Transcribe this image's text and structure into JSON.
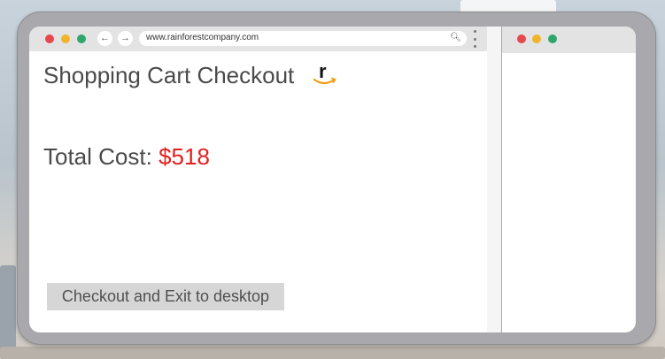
{
  "browser": {
    "url": "www.rainforestcompany.com",
    "back_icon": "arrow-left-icon",
    "forward_icon": "arrow-right-icon",
    "search_icon": "search-icon",
    "menu_icon": "vertical-dots-icon"
  },
  "page": {
    "title": "Shopping Cart Checkout",
    "logo_letter": "r",
    "total_label": "Total Cost: ",
    "total_value": "$518",
    "checkout_button": "Checkout and Exit to desktop"
  },
  "colors": {
    "traffic_red": "#e5484d",
    "traffic_yellow": "#f0b429",
    "traffic_green": "#2fa66b",
    "price_red": "#e02020",
    "logo_smile": "#f39c12"
  }
}
